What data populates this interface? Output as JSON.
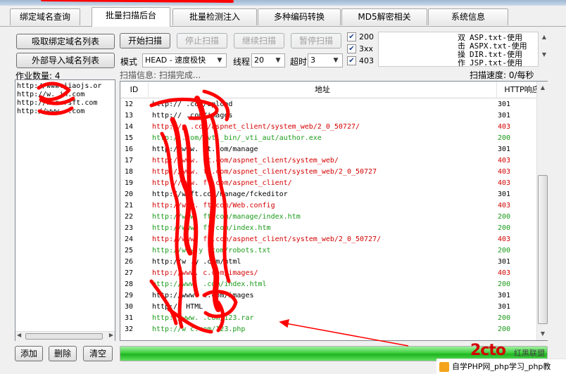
{
  "tabs": [
    {
      "label": "绑定域名查询",
      "active": false
    },
    {
      "label": "批量扫描后台",
      "active": true
    },
    {
      "label": "批量检测注入",
      "active": false
    },
    {
      "label": "多种编码转换",
      "active": false
    },
    {
      "label": "MD5解密相关",
      "active": false
    },
    {
      "label": "系统信息",
      "active": false
    }
  ],
  "left_buttons": {
    "fetch_bound": "吸取绑定域名列表",
    "import_external": "外部导入域名列表"
  },
  "toolbar": {
    "start": "开始扫描",
    "stop": "停止扫描",
    "resume": "继续扫描",
    "pause": "暂停扫描"
  },
  "options": {
    "mode_label": "模式",
    "mode_value": "HEAD - 速度极快",
    "threads_label": "线程",
    "threads_value": "20",
    "timeout_label": "超时",
    "timeout_value": "3"
  },
  "status_filters": [
    {
      "label": "200",
      "checked": true
    },
    {
      "label": "3xx",
      "checked": true
    },
    {
      "label": "403",
      "checked": true
    }
  ],
  "plugins": [
    {
      "char": "双",
      "text": "ASP.txt-使用"
    },
    {
      "char": "击",
      "text": "ASPX.txt-使用"
    },
    {
      "char": "操",
      "text": "DIR.txt-使用"
    },
    {
      "char": "作",
      "text": "JSP.txt-使用"
    }
  ],
  "job_count": "作业数量: 4",
  "scan_info": "扫描信息: 扫描完成...",
  "scan_speed": "扫描速度: 0/每秒",
  "domains": [
    "http://www.jiaojs.or",
    "http://w.    in.com",
    "http://w   s.rsft.com",
    "http://www.      .com"
  ],
  "table": {
    "headers": {
      "id": "ID",
      "url": "地址",
      "code": "HTTP响应"
    },
    "rows": [
      {
        "id": "12",
        "url": "http://         .com/upload",
        "code": "301",
        "color": "black"
      },
      {
        "id": "13",
        "url": "http://      .com/images",
        "code": "301",
        "color": "black"
      },
      {
        "id": "14",
        "url": "http://p       .com/aspnet_client/system_web/2_0_50727/",
        "code": "403",
        "color": "red"
      },
      {
        "id": "15",
        "url": "http:/         .com/_vti_bin/_vti_aut/author.exe",
        "code": "200",
        "color": "green"
      },
      {
        "id": "16",
        "url": "http://www.     ft.com/manage",
        "code": "301",
        "color": "black"
      },
      {
        "id": "17",
        "url": "http://www.      ft.com/aspnet_client/system_web/",
        "code": "403",
        "color": "red"
      },
      {
        "id": "18",
        "url": "http://www.      ft.com/aspnet_client/system_web/2_0_50727",
        "code": "403",
        "color": "red"
      },
      {
        "id": "19",
        "url": "http://www.      ft.com/aspnet_client/",
        "code": "403",
        "color": "red"
      },
      {
        "id": "20",
        "url": "http://w       ft.com/manage/fckeditor",
        "code": "301",
        "color": "black"
      },
      {
        "id": "21",
        "url": "http://www.      ft.com/Web.config",
        "code": "403",
        "color": "red"
      },
      {
        "id": "22",
        "url": "http://www.      ft.com/manage/index.htm",
        "code": "200",
        "color": "green"
      },
      {
        "id": "23",
        "url": "http://www.      ft.com/index.htm",
        "code": "200",
        "color": "green"
      },
      {
        "id": "24",
        "url": "http://www.      ft.com/aspnet_client/system_web/2_0_50727/",
        "code": "403",
        "color": "red"
      },
      {
        "id": "25",
        "url": "http://www.y     .com/robots.txt",
        "code": "200",
        "color": "green"
      },
      {
        "id": "26",
        "url": "http://w   .y     .com/html",
        "code": "301",
        "color": "black"
      },
      {
        "id": "27",
        "url": "http://www.      c.com/images/",
        "code": "403",
        "color": "red"
      },
      {
        "id": "28",
        "url": "http://www.      .com/index.html",
        "code": "200",
        "color": "green"
      },
      {
        "id": "29",
        "url": "http://www.      c.com/images",
        "code": "301",
        "color": "black"
      },
      {
        "id": "30",
        "url": "http://          HTML",
        "code": "301",
        "color": "black"
      },
      {
        "id": "31",
        "url": "http://www.      .com/123.rar",
        "code": "200",
        "color": "green"
      },
      {
        "id": "32",
        "url": "http://w       c.com/123.php",
        "code": "200",
        "color": "green"
      }
    ]
  },
  "bottom_buttons": {
    "add": "添加",
    "delete": "删除",
    "clear": "清空"
  },
  "progress": {
    "fraction": 1.0
  },
  "watermark": {
    "logo": "2cto",
    "right_text": "红黑联盟",
    "bar_text": "自学PHP网_php学习_php教"
  },
  "colors": {
    "row_red": "#d40000",
    "row_green": "#1a9a1a",
    "progress_green": "#2fc42f",
    "annotation_red": "#ff0000"
  }
}
